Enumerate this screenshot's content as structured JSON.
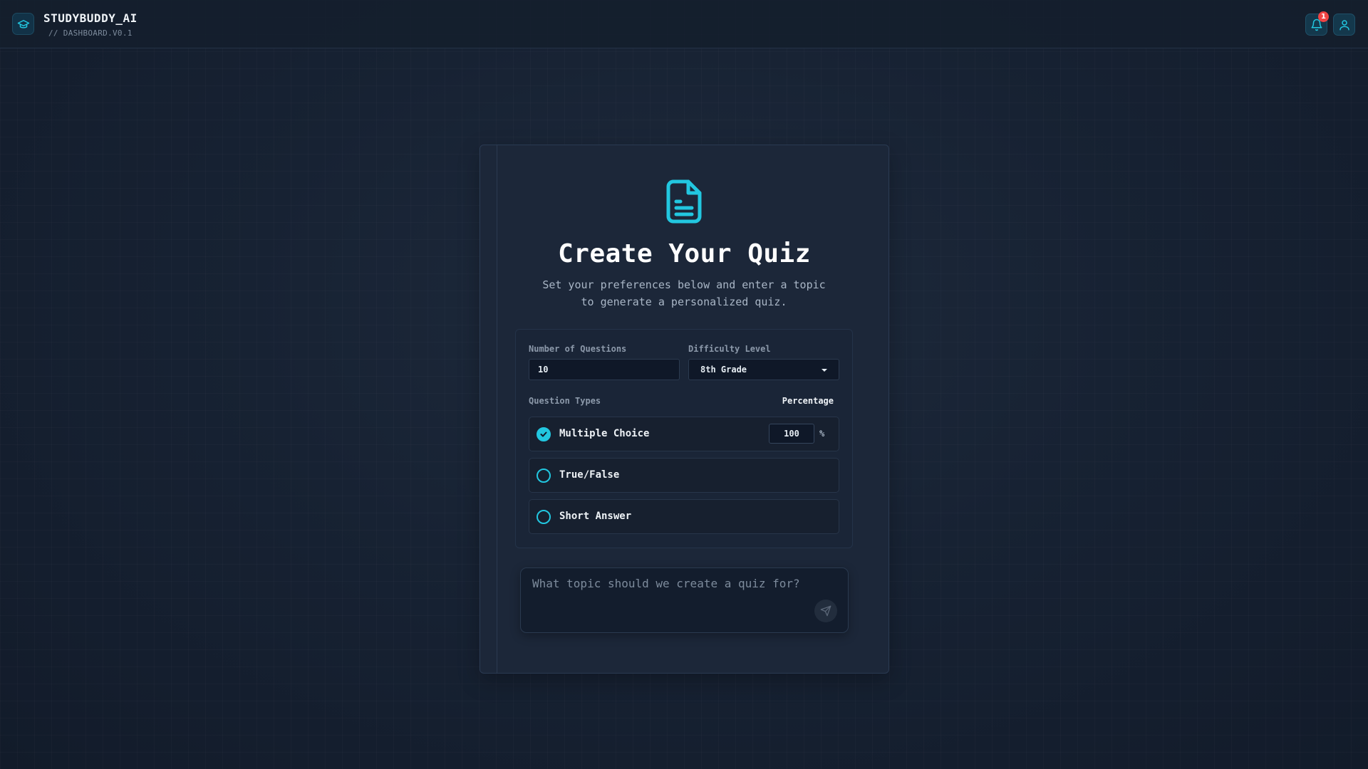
{
  "header": {
    "app_title": "STUDYBUDDY_AI",
    "app_subtitle": "// DASHBOARD.V0.1",
    "notification_count": "1",
    "icons": {
      "logo": "graduation-cap-icon",
      "notifications": "bell-icon",
      "profile": "user-icon"
    }
  },
  "card": {
    "icon": "document-icon",
    "title": "Create Your Quiz",
    "subtitle_line1": "Set your preferences below and enter a topic",
    "subtitle_line2": "to generate a personalized quiz."
  },
  "settings": {
    "num_questions_label": "Number of Questions",
    "num_questions_value": "10",
    "difficulty_label": "Difficulty Level",
    "difficulty_value": "8th Grade",
    "question_types_label": "Question Types",
    "percentage_label": "Percentage",
    "question_types": [
      {
        "label": "Multiple Choice",
        "checked": true,
        "percentage": "100",
        "percent_sign": "%"
      },
      {
        "label": "True/False",
        "checked": false
      },
      {
        "label": "Short Answer",
        "checked": false
      }
    ]
  },
  "topic": {
    "placeholder": "What topic should we create a quiz for?",
    "value": ""
  },
  "colors": {
    "accent": "#22c7e0",
    "badge": "#ef4444",
    "card_bg": "#1c2739",
    "page_bg": "#172233"
  }
}
